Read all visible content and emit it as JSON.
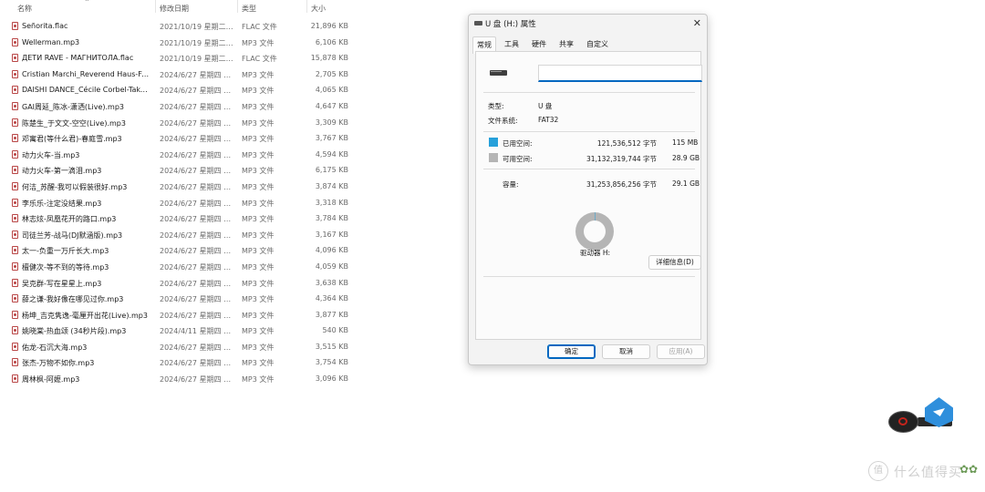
{
  "file_list": {
    "columns": {
      "name": "名称",
      "date": "修改日期",
      "type": "类型",
      "size": "大小"
    },
    "rows": [
      {
        "name": "Señorita.flac",
        "date": "2021/10/19 星期二 1...",
        "type": "FLAC 文件",
        "size": "21,896 KB"
      },
      {
        "name": "Wellerman.mp3",
        "date": "2021/10/19 星期二 1...",
        "type": "MP3 文件",
        "size": "6,106 KB"
      },
      {
        "name": "ДЕТИ RAVE - МАГНИТОЛА.flac",
        "date": "2021/10/19 星期二 1...",
        "type": "FLAC 文件",
        "size": "15,878 KB"
      },
      {
        "name": "Cristian Marchi_Reverend Haus-Fast ...",
        "date": "2024/6/27 星期四 13:...",
        "type": "MP3 文件",
        "size": "2,705 KB"
      },
      {
        "name": "DAISHI DANCE_Cécile Corbel-Take ...",
        "date": "2024/6/27 星期四 13:...",
        "type": "MP3 文件",
        "size": "4,065 KB"
      },
      {
        "name": "GAI周延_陈冰-潇洒(Live).mp3",
        "date": "2024/6/27 星期四 13:...",
        "type": "MP3 文件",
        "size": "4,647 KB"
      },
      {
        "name": "陈楚生_于文文-空空(Live).mp3",
        "date": "2024/6/27 星期四 13:...",
        "type": "MP3 文件",
        "size": "3,309 KB"
      },
      {
        "name": "邓寓君(等什么君)-春庭雪.mp3",
        "date": "2024/6/27 星期四 13:...",
        "type": "MP3 文件",
        "size": "3,767 KB"
      },
      {
        "name": "动力火车-当.mp3",
        "date": "2024/6/27 星期四 13:...",
        "type": "MP3 文件",
        "size": "4,594 KB"
      },
      {
        "name": "动力火车-第一滴泪.mp3",
        "date": "2024/6/27 星期四 13:...",
        "type": "MP3 文件",
        "size": "6,175 KB"
      },
      {
        "name": "何洁_苏醒-我可以假装很好.mp3",
        "date": "2024/6/27 星期四 13:...",
        "type": "MP3 文件",
        "size": "3,874 KB"
      },
      {
        "name": "李乐乐-注定没结果.mp3",
        "date": "2024/6/27 星期四 13:...",
        "type": "MP3 文件",
        "size": "3,318 KB"
      },
      {
        "name": "林志炫-凤凰花开的路口.mp3",
        "date": "2024/6/27 星期四 13:...",
        "type": "MP3 文件",
        "size": "3,784 KB"
      },
      {
        "name": "司徒兰芳-战马(DJ默涵版).mp3",
        "date": "2024/6/27 星期四 13:...",
        "type": "MP3 文件",
        "size": "3,167 KB"
      },
      {
        "name": "太一-负重一万斤长大.mp3",
        "date": "2024/6/27 星期四 13:...",
        "type": "MP3 文件",
        "size": "4,096 KB"
      },
      {
        "name": "檀健次-等不到的等待.mp3",
        "date": "2024/6/27 星期四 13:...",
        "type": "MP3 文件",
        "size": "4,059 KB"
      },
      {
        "name": "吴克群-写在星星上.mp3",
        "date": "2024/6/27 星期四 13:...",
        "type": "MP3 文件",
        "size": "3,638 KB"
      },
      {
        "name": "薛之谦-我好像在哪见过你.mp3",
        "date": "2024/6/27 星期四 13:...",
        "type": "MP3 文件",
        "size": "4,364 KB"
      },
      {
        "name": "杨坤_吉克隽逸-毫厘开出花(Live).mp3",
        "date": "2024/6/27 星期四 13:...",
        "type": "MP3 文件",
        "size": "3,877 KB"
      },
      {
        "name": "姚晓棠-热血颂 (34秒片段).mp3",
        "date": "2024/4/11 星期四 20:...",
        "type": "MP3 文件",
        "size": "540 KB"
      },
      {
        "name": "佑龙-石沉大海.mp3",
        "date": "2024/6/27 星期四 13:...",
        "type": "MP3 文件",
        "size": "3,515 KB"
      },
      {
        "name": "张杰-万物不如你.mp3",
        "date": "2024/6/27 星期四 13:...",
        "type": "MP3 文件",
        "size": "3,754 KB"
      },
      {
        "name": "周林枫-阿嬷.mp3",
        "date": "2024/6/27 星期四 13:...",
        "type": "MP3 文件",
        "size": "3,096 KB"
      }
    ]
  },
  "dialog": {
    "title": "U 盘 (H:) 属性",
    "close_glyph": "✕",
    "tabs": [
      "常规",
      "工具",
      "硬件",
      "共享",
      "自定义"
    ],
    "name_value": "",
    "type_label": "类型:",
    "type_value": "U 盘",
    "fs_label": "文件系统:",
    "fs_value": "FAT32",
    "used_label": "已用空间:",
    "used_bytes": "121,536,512 字节",
    "used_size": "115 MB",
    "free_label": "可用空间:",
    "free_bytes": "31,132,319,744 字节",
    "free_size": "28.9 GB",
    "capacity_label": "容量:",
    "capacity_bytes": "31,253,856,256 字节",
    "capacity_size": "29.1 GB",
    "used_fraction": 0.0039,
    "drive_label": "驱动器 H:",
    "details_button": "详细信息(D)",
    "ok_button": "确定",
    "cancel_button": "取消",
    "apply_button": "应用(A)",
    "colors": {
      "used": "#26a0da",
      "free": "#b5b5b5",
      "accent": "#0067c0"
    }
  },
  "watermark": {
    "glyph": "值",
    "text": "什么值得买"
  }
}
